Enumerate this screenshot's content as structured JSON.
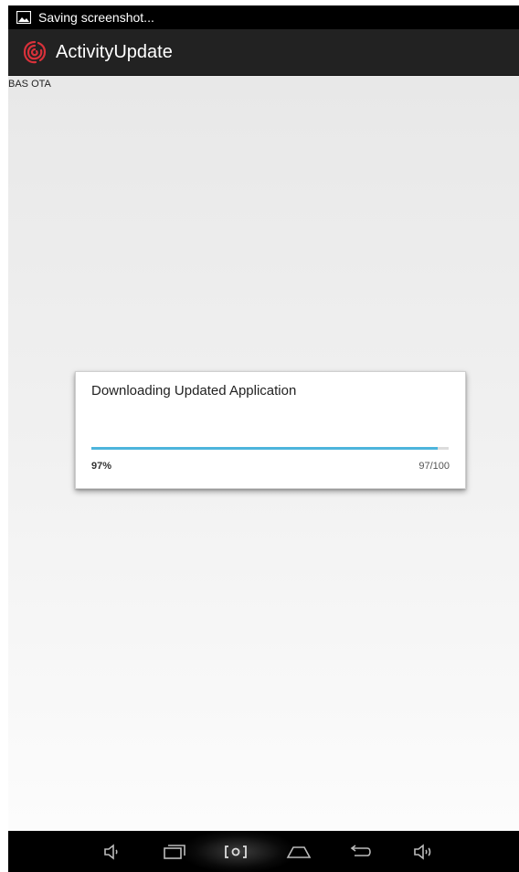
{
  "status_bar": {
    "notification_icon": "image-icon",
    "text": "Saving screenshot..."
  },
  "action_bar": {
    "app_icon": "fingerprint-icon",
    "title": "ActivityUpdate",
    "accent_color": "#d8313a"
  },
  "content": {
    "label": "BAS OTA"
  },
  "dialog": {
    "title": "Downloading Updated Application",
    "progress_percent": "97%",
    "progress_count": "97/100",
    "progress_value": 0.97,
    "progress_color": "#4db5dc"
  },
  "nav_bar": {
    "buttons": [
      {
        "icon": "volume-down-icon"
      },
      {
        "icon": "recent-apps-icon"
      },
      {
        "icon": "screenshot-icon"
      },
      {
        "icon": "home-icon"
      },
      {
        "icon": "back-icon"
      },
      {
        "icon": "volume-up-icon"
      }
    ]
  }
}
